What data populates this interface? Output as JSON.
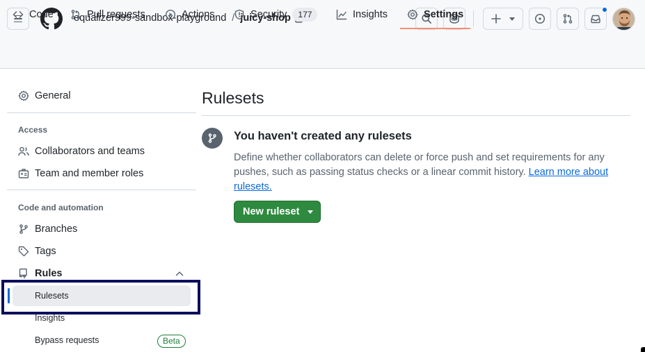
{
  "header": {
    "owner": "equalizer999-sandbox-playground",
    "separator": "/",
    "repo": "juicy-shop"
  },
  "tabs": [
    {
      "label": "Code",
      "icon": "code-icon"
    },
    {
      "label": "Pull requests",
      "icon": "git-pull-request-icon"
    },
    {
      "label": "Actions",
      "icon": "play-icon"
    },
    {
      "label": "Security",
      "icon": "shield-icon",
      "count": "177"
    },
    {
      "label": "Insights",
      "icon": "graph-icon"
    },
    {
      "label": "Settings",
      "icon": "gear-icon",
      "active": true
    }
  ],
  "sidebar": {
    "general": "General",
    "access_heading": "Access",
    "collaborators": "Collaborators and teams",
    "team_roles": "Team and member roles",
    "code_heading": "Code and automation",
    "branches": "Branches",
    "tags": "Tags",
    "rules": "Rules",
    "rulesets": "Rulesets",
    "insights": "Insights",
    "bypass": "Bypass requests",
    "beta": "Beta"
  },
  "main": {
    "title": "Rulesets",
    "blank_title": "You haven't created any rulesets",
    "blank_desc": "Define whether collaborators can delete or force push and set requirements for any pushes, such as passing status checks or a linear commit history.",
    "learn_more": "Learn more about rulesets.",
    "new_button": "New ruleset"
  },
  "colors": {
    "accent": "#0969da",
    "primary_button": "#2d8a3e",
    "active_tab_underline": "#fd8c73",
    "highlight_box": "#0e0e5e"
  }
}
